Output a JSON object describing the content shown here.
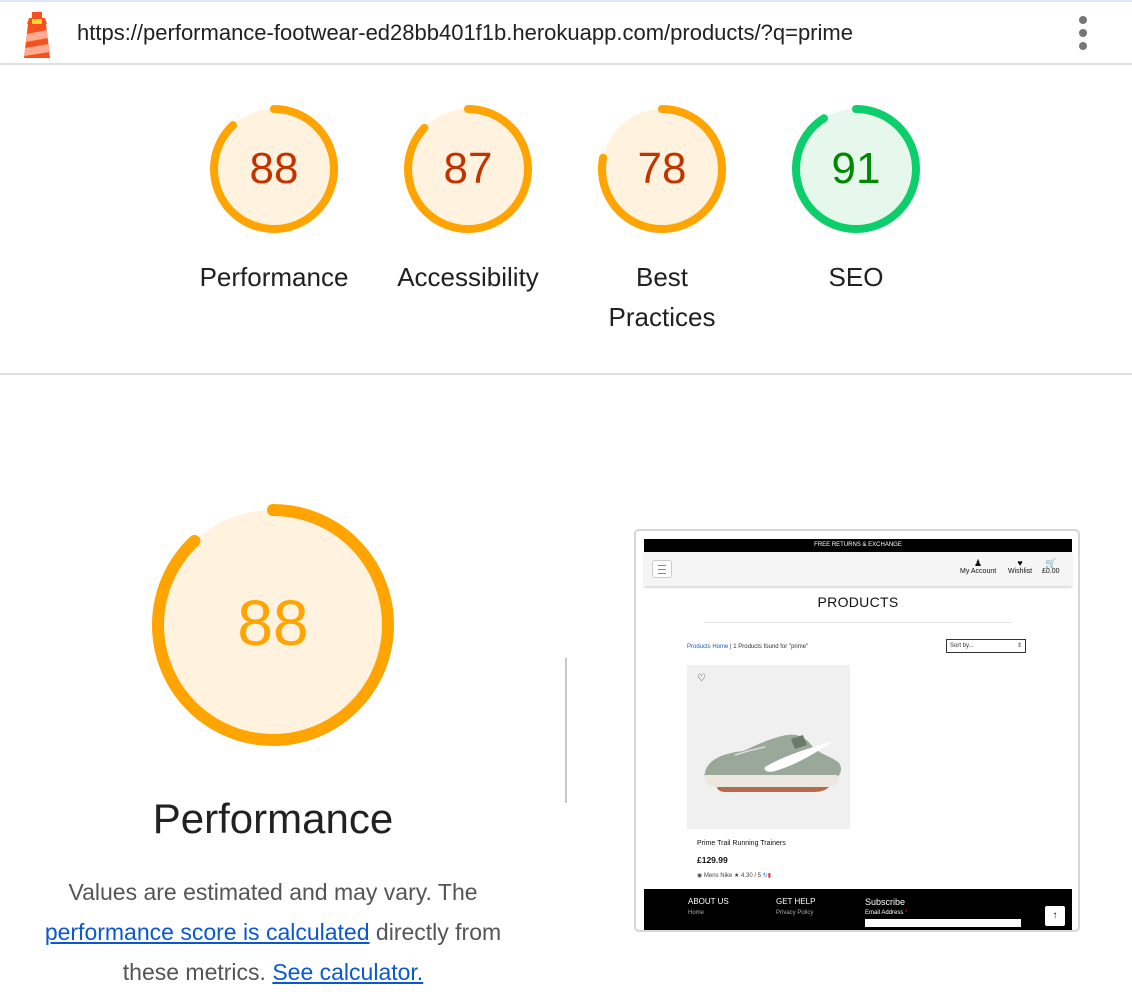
{
  "url_bar": {
    "url": "https://performance-footwear-ed28bb401f1b.herokuapp.com/products/?q=prime",
    "logo_icon": "lighthouse-icon",
    "menu_icon": "more-vert-icon"
  },
  "colors": {
    "average": "#ffa400",
    "average_text": "#c33300",
    "average_fill": "#fff3e0",
    "pass": "#0cce6b",
    "pass_text": "#008800",
    "pass_fill": "#e6f8ec"
  },
  "categories": [
    {
      "label": "Performance",
      "score": "88",
      "fraction": 0.88,
      "rating": "average"
    },
    {
      "label": "Accessibility",
      "score": "87",
      "fraction": 0.87,
      "rating": "average"
    },
    {
      "label_line1": "Best",
      "label_line2": "Practices",
      "score": "78",
      "fraction": 0.78,
      "rating": "average"
    },
    {
      "label": "SEO",
      "score": "91",
      "fraction": 0.91,
      "rating": "pass"
    }
  ],
  "performance": {
    "score": "88",
    "fraction": 0.88,
    "title": "Performance",
    "desc_part1": "Values are estimated and may vary. The",
    "desc_link1": "performance score is calculated",
    "desc_part2": "directly from",
    "desc_part3": "these metrics.",
    "desc_link2": "See calculator."
  },
  "screenshot": {
    "banner": "FREE RETURNS & EXCHANGE",
    "nav": {
      "account": "My Account",
      "wishlist": "Wishlist",
      "bag": "£0.00"
    },
    "page_title": "PRODUCTS",
    "breadcrumb_link": "Products Home",
    "breadcrumb_text": " | 1 Products found for \"prime\"",
    "sort_placeholder": "Sort by...",
    "product": {
      "name": "Prime Trail Running Trainers",
      "price": "£129.99",
      "meta": "Mens Nike",
      "rating": "4.30 / 5"
    },
    "footer": {
      "about": "ABOUT US",
      "about_sub": "Home",
      "help": "GET HELP",
      "help_sub": "Privacy Policy",
      "subscribe": "Subscribe",
      "email_label": "Email Address",
      "email_required": "*"
    }
  }
}
